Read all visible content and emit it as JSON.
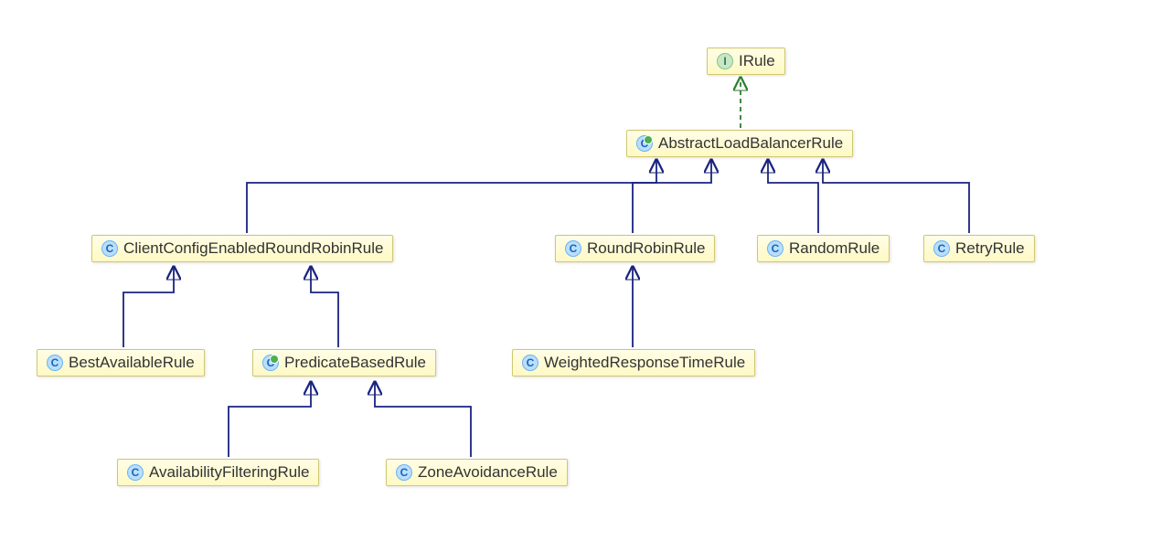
{
  "nodes": {
    "irule": {
      "label": "IRule",
      "kind": "interface"
    },
    "abstract": {
      "label": "AbstractLoadBalancerRule",
      "kind": "abstract-class"
    },
    "clientconfig": {
      "label": "ClientConfigEnabledRoundRobinRule",
      "kind": "class"
    },
    "roundrobin": {
      "label": "RoundRobinRule",
      "kind": "class"
    },
    "random": {
      "label": "RandomRule",
      "kind": "class"
    },
    "retry": {
      "label": "RetryRule",
      "kind": "class"
    },
    "bestavail": {
      "label": "BestAvailableRule",
      "kind": "class"
    },
    "predicate": {
      "label": "PredicateBasedRule",
      "kind": "abstract-class"
    },
    "weighted": {
      "label": "WeightedResponseTimeRule",
      "kind": "class"
    },
    "availfilter": {
      "label": "AvailabilityFilteringRule",
      "kind": "class"
    },
    "zoneavoid": {
      "label": "ZoneAvoidanceRule",
      "kind": "class"
    }
  },
  "edges": [
    {
      "from": "abstract",
      "to": "irule",
      "style": "implements"
    },
    {
      "from": "clientconfig",
      "to": "abstract",
      "style": "extends"
    },
    {
      "from": "roundrobin",
      "to": "abstract",
      "style": "extends"
    },
    {
      "from": "random",
      "to": "abstract",
      "style": "extends"
    },
    {
      "from": "retry",
      "to": "abstract",
      "style": "extends"
    },
    {
      "from": "bestavail",
      "to": "clientconfig",
      "style": "extends"
    },
    {
      "from": "predicate",
      "to": "clientconfig",
      "style": "extends"
    },
    {
      "from": "weighted",
      "to": "roundrobin",
      "style": "extends"
    },
    {
      "from": "availfilter",
      "to": "predicate",
      "style": "extends"
    },
    {
      "from": "zoneavoid",
      "to": "predicate",
      "style": "extends"
    }
  ],
  "colors": {
    "extends": "#1a237e",
    "implements": "#2e7d32",
    "node_fill": "#fff9c4",
    "node_border": "#d0c870"
  }
}
